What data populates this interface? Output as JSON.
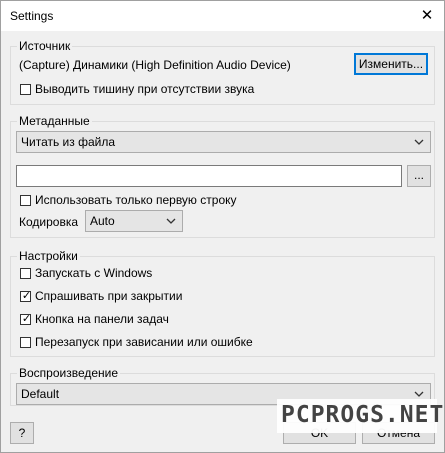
{
  "window": {
    "title": "Settings",
    "close_glyph": "✕"
  },
  "source": {
    "legend": "Источник",
    "device": "(Capture) Динамики (High Definition Audio Device)",
    "change_button": "Изменить...",
    "silence_checkbox": {
      "label": "Выводить тишину при отсутствии звука",
      "checked": false
    }
  },
  "metadata": {
    "legend": "Метаданные",
    "mode_selected": "Читать из файла",
    "file_path_value": "",
    "browse_button": "...",
    "first_line_checkbox": {
      "label": "Использовать только первую строку",
      "checked": false
    },
    "encoding_label": "Кодировка",
    "encoding_selected": "Auto"
  },
  "settings": {
    "legend": "Настройки",
    "checkboxes": [
      {
        "label": "Запускать с Windows",
        "checked": false
      },
      {
        "label": "Спрашивать при закрытии",
        "checked": true
      },
      {
        "label": "Кнопка на панели задач",
        "checked": true
      },
      {
        "label": "Перезапуск при зависании или ошибке",
        "checked": false
      }
    ]
  },
  "playback": {
    "legend": "Воспроизведение",
    "device_selected": "Default"
  },
  "footer": {
    "help_button": "?",
    "ok_button": "OK",
    "cancel_button": "Отмена",
    "watermark": "PCPROGS.NET"
  },
  "colors": {
    "accent": "#0078d7",
    "window_bg": "#f0f0f0"
  }
}
